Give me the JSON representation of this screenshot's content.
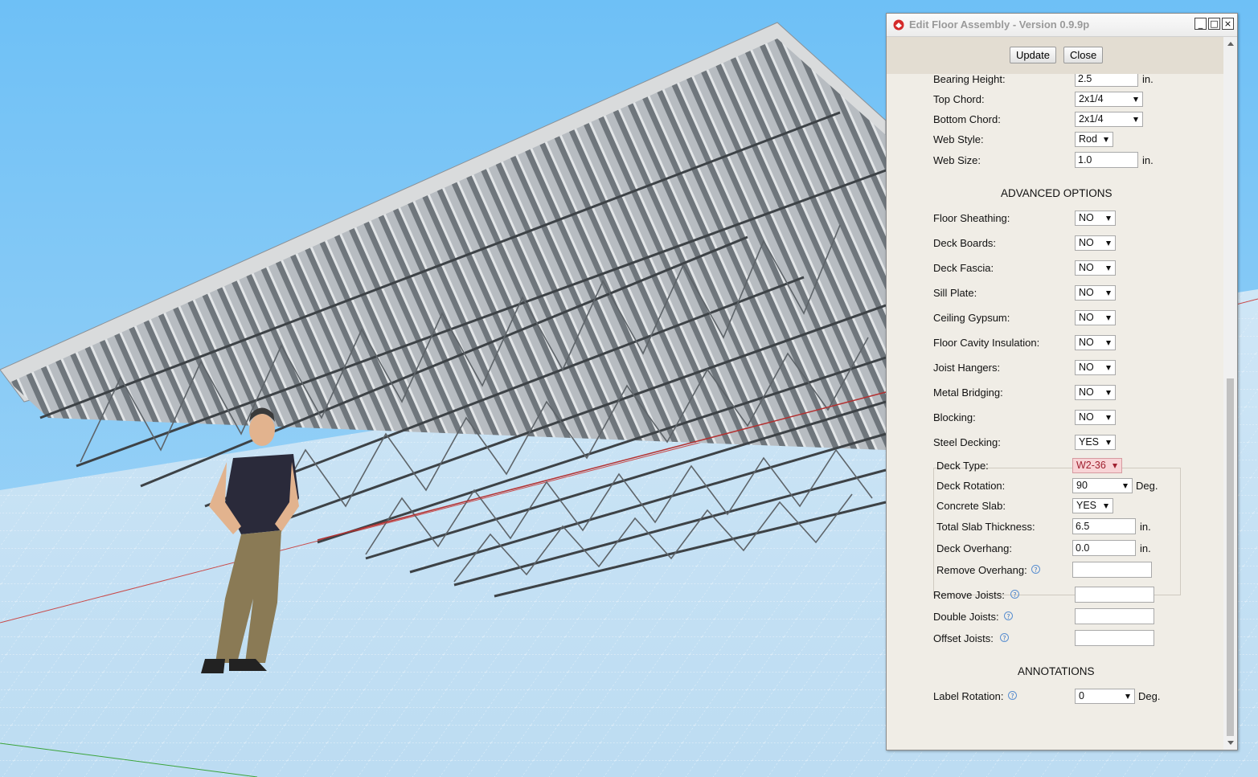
{
  "dialog": {
    "title": "Edit Floor Assembly - Version 0.9.9p",
    "window_buttons": [
      "_",
      "□",
      "×"
    ],
    "toolbar": {
      "update_label": "Update",
      "close_label": "Close"
    }
  },
  "truss_fields": {
    "bearing_height": {
      "label": "Bearing Height:",
      "value": "2.5",
      "unit": "in."
    },
    "top_chord": {
      "label": "Top Chord:",
      "value": "2x1/4"
    },
    "bottom_chord": {
      "label": "Bottom Chord:",
      "value": "2x1/4"
    },
    "web_style": {
      "label": "Web Style:",
      "value": "Rod"
    },
    "web_size": {
      "label": "Web Size:",
      "value": "1.0",
      "unit": "in."
    }
  },
  "advanced": {
    "heading": "ADVANCED OPTIONS",
    "options": [
      {
        "label": "Floor Sheathing:",
        "value": "NO"
      },
      {
        "label": "Deck Boards:",
        "value": "NO"
      },
      {
        "label": "Deck Fascia:",
        "value": "NO"
      },
      {
        "label": "Sill Plate:",
        "value": "NO"
      },
      {
        "label": "Ceiling Gypsum:",
        "value": "NO"
      },
      {
        "label": "Floor Cavity Insulation:",
        "value": "NO"
      },
      {
        "label": "Joist Hangers:",
        "value": "NO"
      },
      {
        "label": "Metal Bridging:",
        "value": "NO"
      },
      {
        "label": "Blocking:",
        "value": "NO"
      },
      {
        "label": "Steel Decking:",
        "value": "YES"
      }
    ]
  },
  "decking": {
    "deck_type": {
      "label": "Deck Type:",
      "value": "W2-36"
    },
    "deck_rotation": {
      "label": "Deck Rotation:",
      "value": "90",
      "unit": "Deg."
    },
    "concrete_slab": {
      "label": "Concrete Slab:",
      "value": "YES"
    },
    "slab_thickness": {
      "label": "Total Slab Thickness:",
      "value": "6.5",
      "unit": "in."
    },
    "deck_overhang": {
      "label": "Deck Overhang:",
      "value": "0.0",
      "unit": "in."
    },
    "remove_overhang": {
      "label": "Remove Overhang:",
      "value": ""
    }
  },
  "joist_edits": {
    "remove_joists": {
      "label": "Remove Joists:",
      "value": ""
    },
    "double_joists": {
      "label": "Double Joists:",
      "value": ""
    },
    "offset_joists": {
      "label": "Offset Joists:",
      "value": ""
    }
  },
  "annotations": {
    "heading": "ANNOTATIONS",
    "label_rotation": {
      "label": "Label Rotation:",
      "value": "0",
      "unit": "Deg."
    }
  },
  "help_glyph": "?",
  "colors": {
    "sky": "#8ec8f0",
    "ground": "#c9e3f4",
    "steel": "#9aa0a6",
    "dialog_bg": "#f0ede6",
    "warn_select": "#f8d4d6"
  }
}
